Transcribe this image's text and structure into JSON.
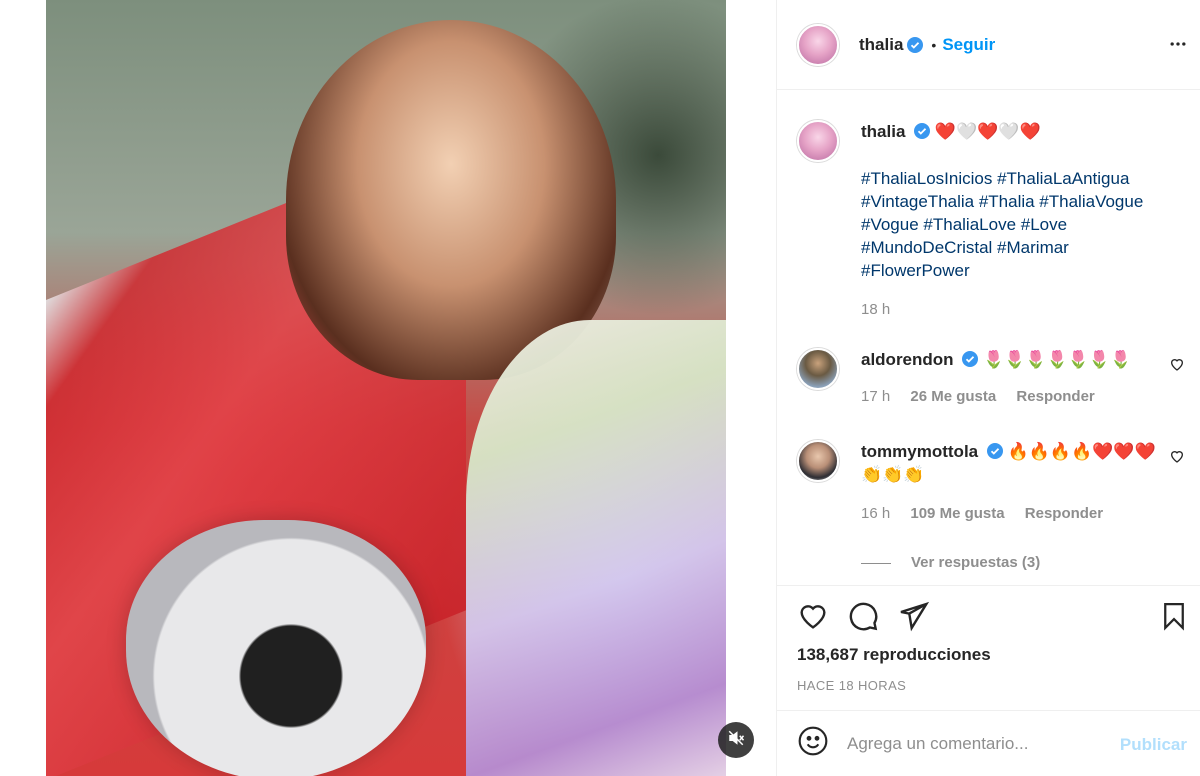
{
  "post": {
    "media_alt": "Photo of thalia holding a gold/silver record plaque",
    "mute_icon": "speaker-muted-icon"
  },
  "header": {
    "username": "thalia",
    "separator": "•",
    "follow_label": "Seguir",
    "more_icon": "more-options-icon"
  },
  "caption": {
    "username": "thalia",
    "emojis": "❤️🤍❤️🤍❤️",
    "hashtags_line1": "#ThaliaLosInicios #ThaliaLaAntigua",
    "hashtags_line2": "#VintageThalia #Thalia #ThaliaVogue",
    "hashtags_line3": "#Vogue #ThaliaLove #Love",
    "hashtags_line4": "#MundoDeCristal #Marimar",
    "hashtags_line5": "#FlowerPower",
    "time": "18 h"
  },
  "comments": [
    {
      "username": "aldorendon",
      "text": "🌷🌷🌷🌷🌷🌷🌷",
      "time": "17 h",
      "likes": "26 Me gusta",
      "reply": "Responder"
    },
    {
      "username": "tommymottola",
      "text": "🔥🔥🔥🔥❤️❤️❤️",
      "text2": "👏👏👏",
      "time": "16 h",
      "likes": "109 Me gusta",
      "reply": "Responder"
    }
  ],
  "view_replies": "Ver respuestas (3)",
  "stats": {
    "views": "138,687 reproducciones",
    "time_ago": "HACE 18 HORAS"
  },
  "composer": {
    "placeholder": "Agrega un comentario...",
    "publish_label": "Publicar"
  },
  "colors": {
    "accent": "#0095f6",
    "hashtag": "#00376b",
    "muted_text": "#8e8e8e",
    "publish_disabled": "#b2dffc"
  }
}
